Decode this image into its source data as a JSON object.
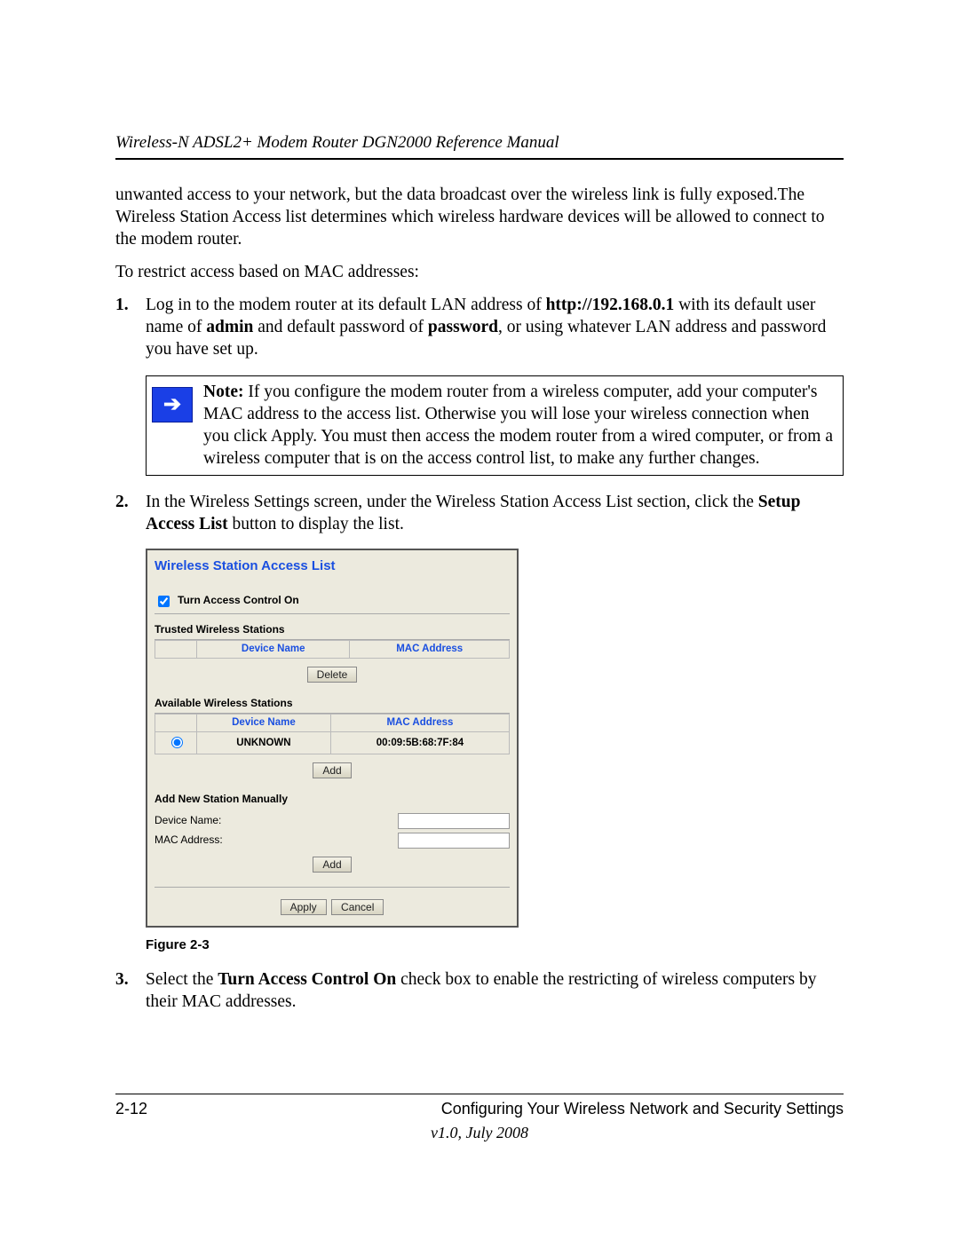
{
  "header": {
    "title": "Wireless-N ADSL2+ Modem Router DGN2000 Reference Manual"
  },
  "body": {
    "intro": "unwanted access to your network, but the data broadcast over the wireless link is fully exposed.The Wireless Station Access list determines which wireless hardware devices will be allowed to connect to the modem router.",
    "lead": "To restrict access based on MAC addresses:",
    "step1": {
      "num": "1.",
      "pre": "Log in to the modem router at its default LAN address of ",
      "url": "http://192.168.0.1",
      "mid1": " with its default user name of ",
      "admin": "admin",
      "mid2": " and default password of ",
      "password": "password",
      "post": ", or using whatever LAN address and password you have set up."
    },
    "note": {
      "label": "Note:",
      "text": " If you configure the modem router from a wireless computer, add your computer's MAC address to the access list. Otherwise you will lose your wireless connection when you click Apply. You must then access the modem router from a wired computer, or from a wireless computer that is on the access control list, to make any further changes."
    },
    "step2": {
      "num": "2.",
      "pre": "In the Wireless Settings screen, under the Wireless Station Access List section, click the ",
      "btn": "Setup Access List",
      "post": " button to display the list."
    },
    "figure_caption": "Figure 2-3",
    "step3": {
      "num": "3.",
      "pre": "Select the ",
      "chk": "Turn Access Control On",
      "post": " check box to enable the restricting of wireless computers by their MAC addresses."
    }
  },
  "panel": {
    "title": "Wireless Station Access List",
    "toggle_label": "Turn Access Control On",
    "trusted_heading": "Trusted Wireless Stations",
    "available_heading": "Available Wireless Stations",
    "col_device": "Device Name",
    "col_mac": "MAC Address",
    "available_rows": [
      {
        "device": "UNKNOWN",
        "mac": "00:09:5B:68:7F:84"
      }
    ],
    "manual_heading": "Add New Station Manually",
    "device_name_label": "Device Name:",
    "mac_label": "MAC Address:",
    "btn_delete": "Delete",
    "btn_add": "Add",
    "btn_apply": "Apply",
    "btn_cancel": "Cancel"
  },
  "footer": {
    "page": "2-12",
    "section": "Configuring Your Wireless Network and Security Settings",
    "version": "v1.0, July 2008"
  }
}
